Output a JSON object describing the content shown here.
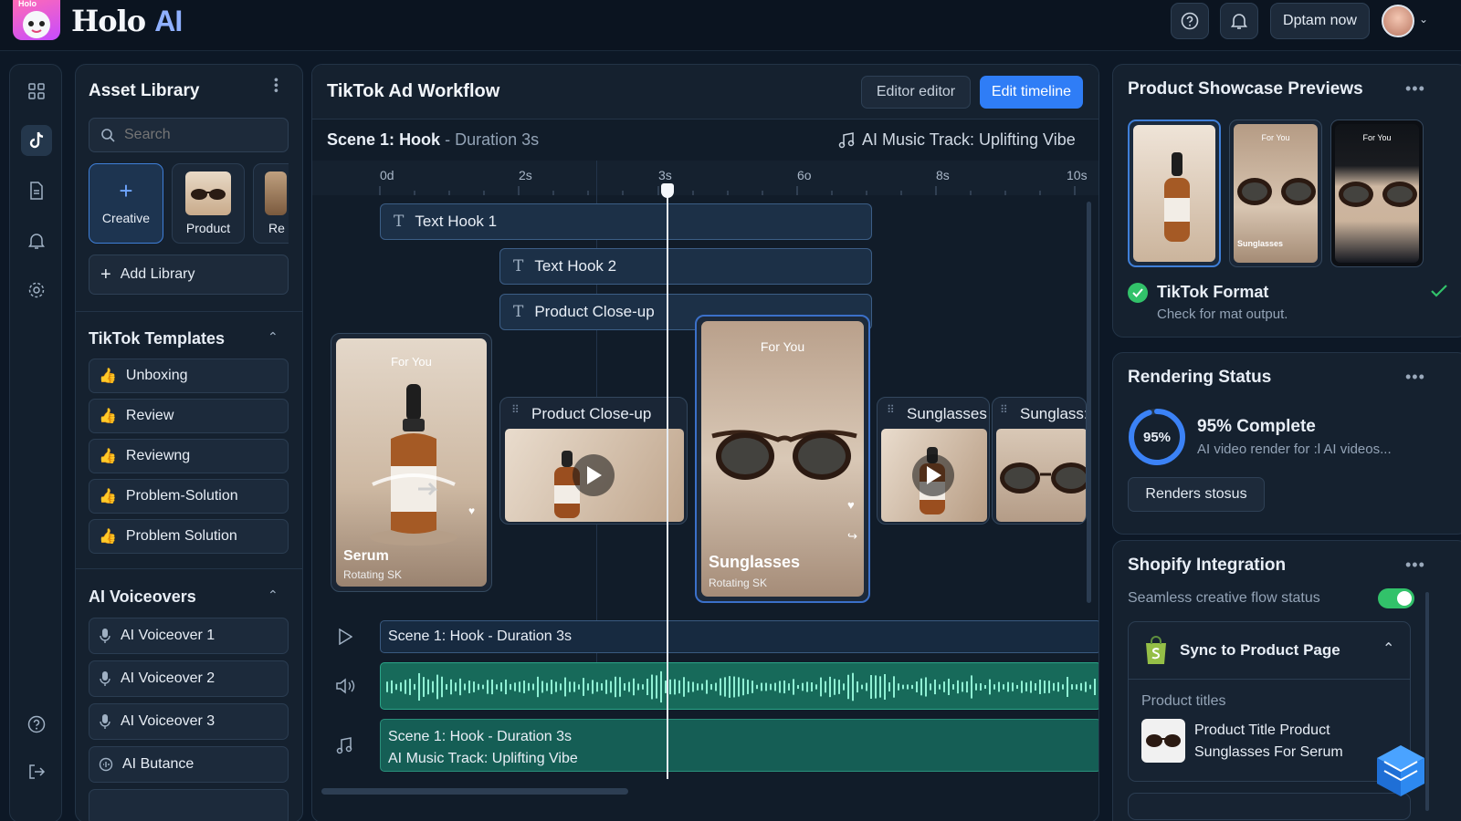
{
  "app": {
    "logo_text": "Holo",
    "logo_accent": "AI",
    "logo_badge": "Holo",
    "accent": "#2f7df6",
    "success": "#32c26a"
  },
  "header": {
    "cta_label": "Dptam now",
    "icons": [
      "help-icon",
      "bell-icon",
      "avatar"
    ]
  },
  "rail": {
    "icons": [
      "grid-icon",
      "tiktok-icon",
      "file-icon",
      "bell-icon",
      "gear-icon",
      "help-icon",
      "logout-icon"
    ]
  },
  "assets": {
    "title": "Asset Library",
    "search_placeholder": "Search",
    "tiles": [
      {
        "label": "Creative"
      },
      {
        "label": "Product"
      },
      {
        "label": "Re"
      }
    ],
    "add_label": "Add Library",
    "templates_title": "TikTok Templates",
    "templates": [
      "Unboxing",
      "Review",
      "Reviewng",
      "Problem-Solution",
      "Problem Solution"
    ],
    "voiceovers_title": "AI Voiceovers",
    "voiceovers": [
      "AI Voiceover 1",
      "AI Voiceover 2",
      "AI Voiceover 3",
      "AI Butance"
    ]
  },
  "workflow": {
    "title": "TikTok Ad Workflow",
    "editor_label": "Editor editor",
    "edit_timeline_label": "Edit timeline",
    "scene_label": "Scene 1:",
    "scene_name": "Hook",
    "scene_duration": "- Duration 3s",
    "music_label": "AI Music Track: Uplifting Vibe",
    "ruler": [
      "0d",
      "2s",
      "3s",
      "6o",
      "8s",
      "10s"
    ],
    "text_hooks": [
      "Text Hook 1",
      "Text Hook 2",
      "Product Close-up"
    ],
    "cards": [
      {
        "tag": "For You",
        "title": "Serum",
        "sub": "Rotating SK"
      },
      {
        "tag": "For You",
        "title": "Sunglasses",
        "sub": "Rotating SK"
      }
    ],
    "clips": [
      "Product Close-up",
      "Sunglasses",
      "Sunglass:"
    ],
    "track_scene": "Scene 1: Hook - Duration 3s",
    "track_music_line1": "Scene 1: Hook - Duration 3s",
    "track_music_line2": "AI Music Track: Uplifting Vibe"
  },
  "showcase": {
    "title": "Product Showcase Previews",
    "thumb_tags": [
      "For You",
      "For You"
    ],
    "thumb_captions": [
      "Sunglasses"
    ],
    "format_title": "TikTok Format",
    "format_sub": "Check for mat output."
  },
  "rendering": {
    "title": "Rendering Status",
    "percent_text": "95%",
    "progress": 0.95,
    "complete_label": "95% Complete",
    "sub": "AI video render for :l AI videos...",
    "button_label": "Renders stosus"
  },
  "shopify": {
    "title": "Shopify Integration",
    "flow_label": "Seamless creative flow status",
    "toggle_on": true,
    "sync_label": "Sync to Product Page",
    "product_titles_label": "Product titles",
    "product_line1": "Product Title Product",
    "product_line2": "Sunglasses For Serum"
  }
}
